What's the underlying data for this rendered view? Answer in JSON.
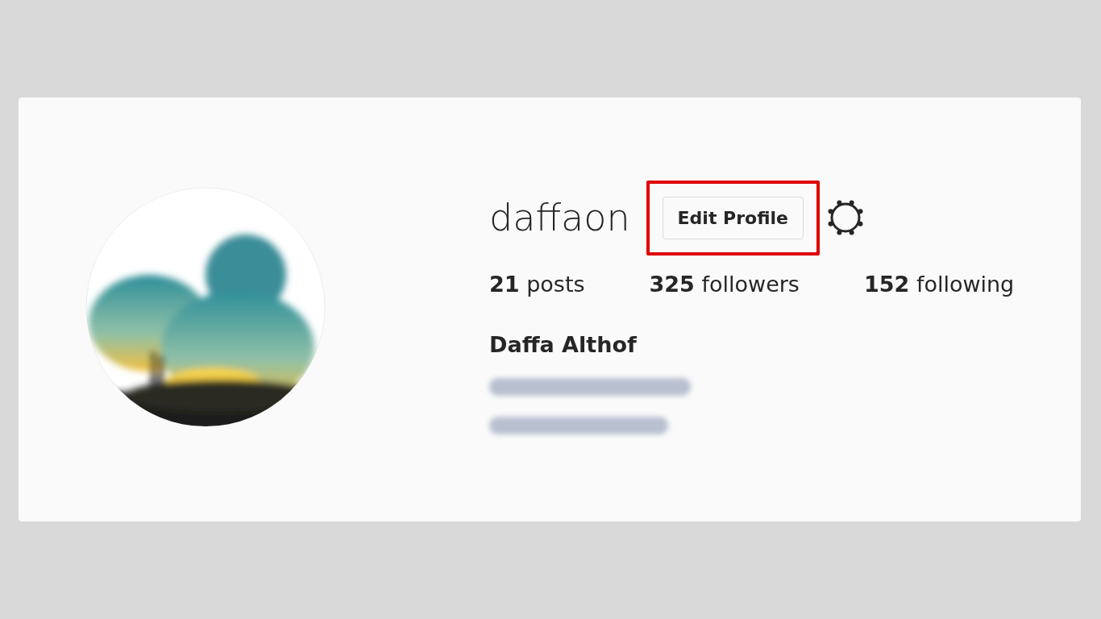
{
  "profile": {
    "username": "daffaon",
    "edit_button": {
      "label": "Edit Profile",
      "highlighted": true
    },
    "stats": [
      {
        "count": "21",
        "label": "posts"
      },
      {
        "count": "325",
        "label": "followers"
      },
      {
        "count": "152",
        "label": "following"
      }
    ],
    "full_name": "Daffa Althof"
  }
}
